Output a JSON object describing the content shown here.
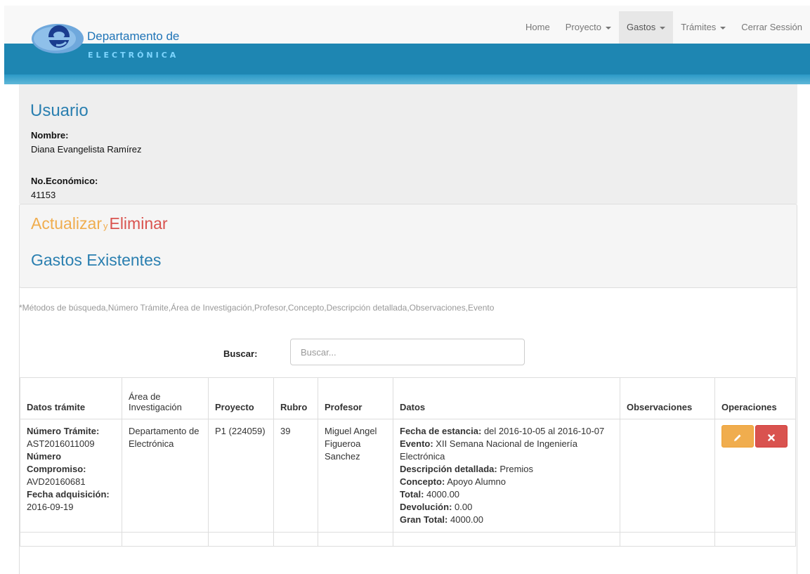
{
  "logo": {
    "line1": "Departamento de",
    "line2": "ELECTRÓNICA"
  },
  "nav": {
    "items": [
      {
        "label": "Home",
        "caret": false
      },
      {
        "label": "Proyecto",
        "caret": true
      },
      {
        "label": "Gastos",
        "caret": true,
        "active": true
      },
      {
        "label": "Trámites",
        "caret": true
      },
      {
        "label": "Cerrar Sessión",
        "caret": false
      }
    ]
  },
  "user": {
    "title": "Usuario",
    "nombre_label": "Nombre:",
    "nombre": "Diana Evangelista Ramírez",
    "economico_label": "No.Económico:",
    "economico": "41153"
  },
  "gastos": {
    "actualizar": "Actualizar",
    "y": "y",
    "eliminar": "Eliminar",
    "title": "Gastos Existentes",
    "metodos": "*Métodos de búsqueda,Número Trámite,Área de Investigación,Profesor,Concepto,Descripción detallada,Observaciones,Evento",
    "buscar_label": "Buscar:",
    "buscar_placeholder": "Buscar..."
  },
  "table": {
    "headers": {
      "datos_tramite": "Datos trámite",
      "area": "Área de Investigación",
      "proyecto": "Proyecto",
      "rubro": "Rubro",
      "profesor": "Profesor",
      "datos": "Datos",
      "observaciones": "Observaciones",
      "operaciones": "Operaciones"
    },
    "rows": [
      {
        "tramite_label": "Número Trámite:",
        "tramite": "AST2016011009",
        "compromiso_label": "Número Compromiso:",
        "compromiso": "AVD20160681",
        "fecha_label": "Fecha adquisición:",
        "fecha": "2016-09-19",
        "area": "Departamento de Electrónica",
        "proyecto": "P1 (224059)",
        "rubro": "39",
        "profesor": "Miguel Angel Figueroa Sanchez",
        "estancia_label": "Fecha de estancia:",
        "estancia": "del 2016-10-05 al 2016-10-07",
        "evento_label": "Evento:",
        "evento": "XII Semana Nacional de Ingeniería Electrónica",
        "descripcion_label": "Descripción detallada:",
        "descripcion": "Premios",
        "concepto_label": "Concepto:",
        "concepto": "Apoyo Alumno",
        "total_label": "Total:",
        "total": "4000.00",
        "devolucion_label": "Devolución:",
        "devolucion": "0.00",
        "gran_total_label": "Gran Total:",
        "gran_total": "4000.00",
        "observaciones": ""
      }
    ]
  },
  "icons": {
    "edit": "pencil-icon",
    "delete": "remove-icon"
  },
  "colors": {
    "brand_blue": "#1e86b2",
    "title_blue": "#2a7fb0",
    "warning": "#f0ad4e",
    "danger": "#d9534f"
  }
}
